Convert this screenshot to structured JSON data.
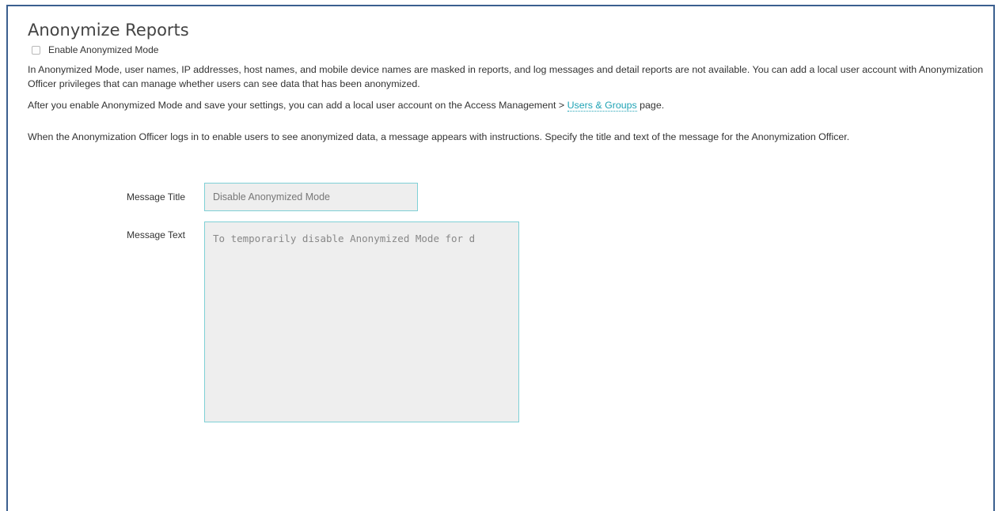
{
  "section": {
    "title": "Anonymize Reports",
    "checkbox_label": "Enable Anonymized Mode",
    "paragraph1": "In Anonymized Mode, user names, IP addresses, host names, and mobile device names are masked in reports, and log messages and detail reports are not available. You can add a local user account with Anonymization Officer privileges that can manage whether users can see data that has been anonymized.",
    "paragraph2_before": "After you enable Anonymized Mode and save your settings, you can add a local user account on the Access Management > ",
    "paragraph2_link": "Users & Groups",
    "paragraph2_after": " page.",
    "paragraph3": "When the Anonymization Officer logs in to enable users to see anonymized data, a message appears with instructions. Specify the title and text of the message for the Anonymization Officer."
  },
  "form": {
    "message_title_label": "Message Title",
    "message_title_value": "Disable Anonymized Mode",
    "message_text_label": "Message Text",
    "message_text_value": "To temporarily disable Anonymized Mode for d"
  },
  "colors": {
    "link": "#1fa3b5",
    "panel_border": "#3b5f8f",
    "input_border": "#7fd0d6"
  }
}
